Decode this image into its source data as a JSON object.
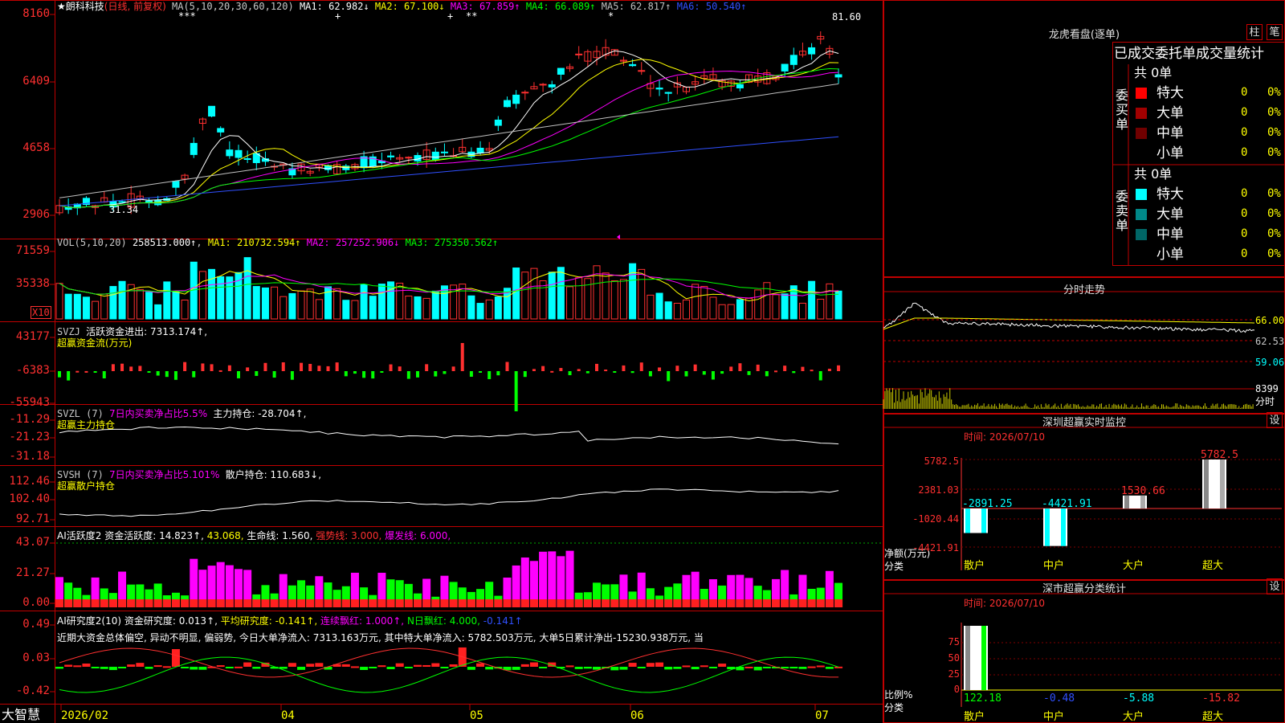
{
  "stock": {
    "name": "★朗科科技",
    "mode": "(日线, 前复权)",
    "stars": [
      "***",
      "+",
      "+",
      "**",
      "*"
    ]
  },
  "colors": {
    "up": "#ff3030",
    "down": "#00ffff",
    "grid": "#c00000",
    "ma1": "#ffffff",
    "ma2": "#ffff00",
    "ma3": "#ff00ff",
    "ma4": "#00ff00",
    "ma5": "#c0c0c0",
    "ma6": "#3050ff"
  },
  "main_panel": {
    "ma_label": "MA(5,10,20,30,60,120)",
    "ma": [
      {
        "label": "MA1:",
        "value": "62.982↓",
        "color": "#ffffff"
      },
      {
        "label": "MA2:",
        "value": "67.100↓",
        "color": "#ffff00"
      },
      {
        "label": "MA3:",
        "value": "67.859↑",
        "color": "#ff00ff"
      },
      {
        "label": "MA4:",
        "value": "66.089↑",
        "color": "#00ff00"
      },
      {
        "label": "MA5:",
        "value": "62.817↑",
        "color": "#c0c0c0"
      },
      {
        "label": "MA6:",
        "value": "50.540↑",
        "color": "#3050ff"
      }
    ],
    "axis": [
      "8160",
      "6409",
      "4658",
      "2906"
    ],
    "high_label": "81.60",
    "low_label": "31.34"
  },
  "vol_panel": {
    "label": "VOL(5,10,20)",
    "value": "258513.000↑",
    "ma": [
      {
        "label": "MA1:",
        "value": "210732.594↑",
        "color": "#ffff00"
      },
      {
        "label": "MA2:",
        "value": "257252.906↓",
        "color": "#ff00ff"
      },
      {
        "label": "MA3:",
        "value": "275350.562↑",
        "color": "#00ff00"
      }
    ],
    "axis": [
      "71559",
      "35338"
    ],
    "unit": "X10"
  },
  "svzj_panel": {
    "label": "SVZJ",
    "title": "活跃资金进出: 7313.174↑,",
    "subtitle": "超赢资金流(万元)",
    "axis": [
      "43177",
      "-6383",
      "-55943"
    ]
  },
  "svzl_panel": {
    "label": "SVZL (7)",
    "desc": "7日内买卖净占比5.5%",
    "value": "主力持仓: -28.704↑,",
    "subtitle": "超赢主力持仓",
    "axis": [
      "-11.29",
      "-21.23",
      "-31.18"
    ]
  },
  "svsh_panel": {
    "label": "SVSH (7)",
    "desc": "7日内买卖净占比5.101%",
    "value": "散户持仓: 110.683↓,",
    "subtitle": "超赢散户持仓",
    "axis": [
      "112.46",
      "102.40",
      "92.71"
    ]
  },
  "ai_panel": {
    "label": "AI活跃度2",
    "fund": "资金活跃度: 14.823↑,",
    "v2": "43.068,",
    "life": "生命线: 1.560,",
    "strong": "强势线: 3.000,",
    "burst": "爆发线: 6.000,",
    "axis": [
      "43.07",
      "21.27",
      "0.00"
    ]
  },
  "ai_research": {
    "label": "AI研究度2(10)",
    "research": "资金研究度: 0.013↑,",
    "avg": "平均研究度: -0.141↑,",
    "cont": "连续飘红: 1.000↑,",
    "n": "N日飘红: 4.000,",
    "v": "-0.141↑",
    "text": "近期大资金总体偏空, 异动不明显, 偏弱势, 今日大单净流入: 7313.163万元, 其中特大单净流入: 5782.503万元, 大单5日累计净出-15230.938万元, 当",
    "axis": [
      "0.49",
      "0.03",
      "-0.42"
    ]
  },
  "xaxis": {
    "brand": "大智慧",
    "labels": [
      "2026/02",
      "04",
      "05",
      "06",
      "07"
    ]
  },
  "lhb": {
    "title": "龙虎看盘(逐单)",
    "btn1": "柱",
    "btn2": "笔",
    "subtitle": "已成交委托单成交量统计",
    "buy_label": "委买单",
    "sell_label": "委卖单",
    "buy_total": "共 0单",
    "sell_total": "共 0单",
    "buy_rows": [
      {
        "name": "特大",
        "n": "0",
        "pct": "0%",
        "color": "#ff0000"
      },
      {
        "name": "大单",
        "n": "0",
        "pct": "0%",
        "color": "#a00000"
      },
      {
        "name": "中单",
        "n": "0",
        "pct": "0%",
        "color": "#700000"
      },
      {
        "name": "小单",
        "n": "0",
        "pct": "0%",
        "color": ""
      }
    ],
    "sell_rows": [
      {
        "name": "特大",
        "n": "0",
        "pct": "0%",
        "color": "#00ffff"
      },
      {
        "name": "大单",
        "n": "0",
        "pct": "0%",
        "color": "#008888"
      },
      {
        "name": "中单",
        "n": "0",
        "pct": "0%",
        "color": "#006666"
      },
      {
        "name": "小单",
        "n": "0",
        "pct": "0%",
        "color": ""
      }
    ]
  },
  "fenshi": {
    "title": "分时走势",
    "axis": [
      "66.00",
      "62.53",
      "59.06"
    ],
    "vol_label": "8399",
    "unit": "分时"
  },
  "sz_monitor": {
    "title": "深圳超赢实时监控",
    "btn": "设",
    "time": "时间: 2026/07/10",
    "axis": [
      "5782.5",
      "2381.03",
      "-1020.44",
      "-4421.91"
    ],
    "ylabel": "净额(万元)",
    "xlabel": "分类",
    "bars": [
      {
        "cat": "散户",
        "value": -2891.25,
        "label": "-2891.25",
        "color": "#00ffff"
      },
      {
        "cat": "中户",
        "value": -4421.91,
        "label": "-4421.91",
        "color": "#00ffff"
      },
      {
        "cat": "大户",
        "value": 1530.66,
        "label": "1530.66",
        "color": "#ff3030"
      },
      {
        "cat": "超大",
        "value": 5782.5,
        "label": "5782.5",
        "color": "#ff3030"
      }
    ]
  },
  "sz_stats": {
    "title": "深市超赢分类统计",
    "btn": "设",
    "time": "时间: 2026/07/10",
    "axis": [
      "75",
      "50",
      "25",
      "0"
    ],
    "ylabel": "比例%",
    "xlabel": "分类",
    "bars": [
      {
        "cat": "散户",
        "value": 122.18,
        "label": "122.18",
        "color": "#00ff00"
      },
      {
        "cat": "中户",
        "value": -0.48,
        "label": "-0.48",
        "color": "#3050ff"
      },
      {
        "cat": "大户",
        "value": -5.88,
        "label": "-5.88",
        "color": "#00ffff"
      },
      {
        "cat": "超大",
        "value": -15.82,
        "label": "-15.82",
        "color": "#ff3030"
      }
    ]
  }
}
